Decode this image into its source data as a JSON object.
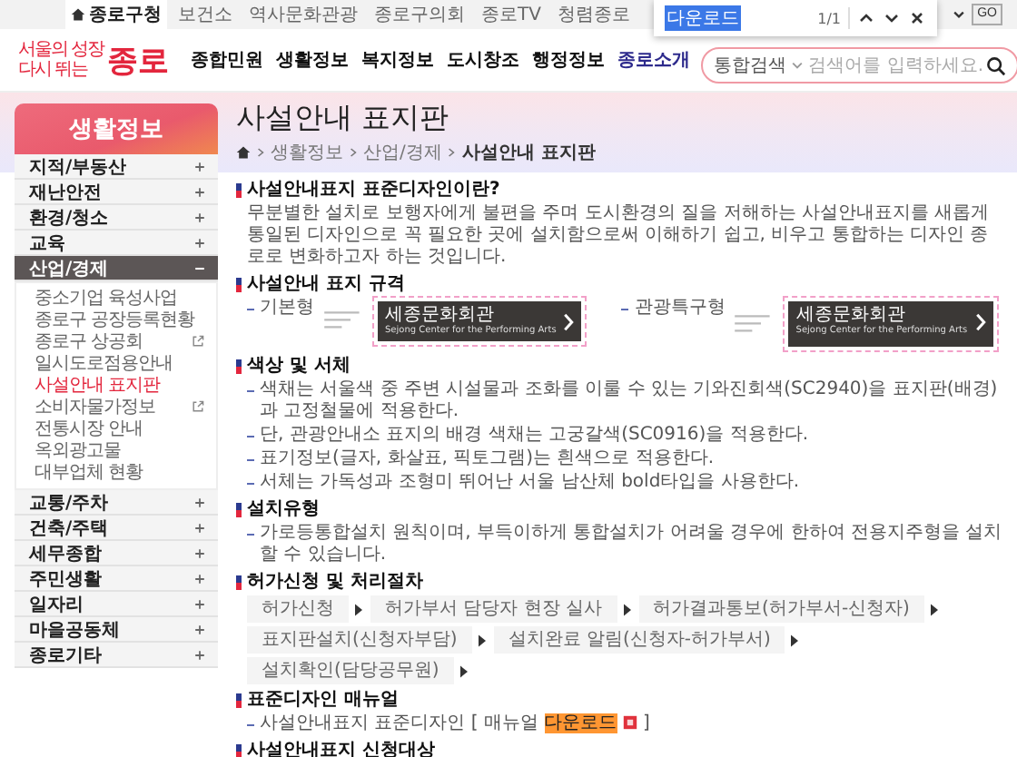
{
  "top_bar": {
    "links": [
      {
        "label": "종로구청",
        "selected": true
      },
      {
        "label": "보건소",
        "selected": false
      },
      {
        "label": "역사문화관광",
        "selected": false
      },
      {
        "label": "종로구의회",
        "selected": false
      },
      {
        "label": "종로TV",
        "selected": false
      },
      {
        "label": "청렴종로",
        "selected": false
      }
    ],
    "go_button": "GO"
  },
  "find_bar": {
    "value": "다운로드",
    "count": "1/1"
  },
  "header": {
    "logo": {
      "line_1": "서울의 성장",
      "line_2": "다시 뛰는",
      "name": "종로"
    },
    "nav": [
      {
        "label": "종합민원",
        "selected": false
      },
      {
        "label": "생활정보",
        "selected": false
      },
      {
        "label": "복지정보",
        "selected": false
      },
      {
        "label": "도시창조",
        "selected": false
      },
      {
        "label": "행정정보",
        "selected": false
      },
      {
        "label": "종로소개",
        "selected": true
      }
    ],
    "search": {
      "scope": "통합검색",
      "placeholder": "검색어를 입력하세요."
    }
  },
  "sidebar": {
    "title": "생활정보",
    "items": [
      {
        "label": "지적/부동산",
        "expanded": false
      },
      {
        "label": "재난안전",
        "expanded": false
      },
      {
        "label": "환경/청소",
        "expanded": false
      },
      {
        "label": "교육",
        "expanded": false
      },
      {
        "label": "산업/경제",
        "expanded": true,
        "children": [
          {
            "label": "중소기업 육성사업",
            "selected": false,
            "external": false
          },
          {
            "label": "종로구 공장등록현황",
            "selected": false,
            "external": false
          },
          {
            "label": "종로구 상공회",
            "selected": false,
            "external": true
          },
          {
            "label": "일시도로점용안내",
            "selected": false,
            "external": false
          },
          {
            "label": "사설안내 표지판",
            "selected": true,
            "external": false
          },
          {
            "label": "소비자물가정보",
            "selected": false,
            "external": true
          },
          {
            "label": "전통시장 안내",
            "selected": false,
            "external": false
          },
          {
            "label": "옥외광고물",
            "selected": false,
            "external": false
          },
          {
            "label": "대부업체 현황",
            "selected": false,
            "external": false
          }
        ]
      },
      {
        "label": "교통/주차",
        "expanded": false
      },
      {
        "label": "건축/주택",
        "expanded": false
      },
      {
        "label": "세무종합",
        "expanded": false
      },
      {
        "label": "주민생활",
        "expanded": false
      },
      {
        "label": "일자리",
        "expanded": false
      },
      {
        "label": "마을공동체",
        "expanded": false
      },
      {
        "label": "종로기타",
        "expanded": false
      }
    ]
  },
  "page": {
    "title": "사설안내 표지판",
    "breadcrumb": [
      "생활정보",
      "산업/경제",
      "사설안내 표지판"
    ],
    "sections": [
      {
        "kind": "paragraph",
        "heading": "사설안내표지 표준디자인이란?",
        "text": "무분별한 설치로 보행자에게 불편을 주며 도시환경의 질을 저해하는 사설안내표지를 새롭게 통일된 디자인으로 꼭 필요한 곳에 설치함으로써 이해하기 쉽고, 비우고 통합하는 디자인 종로로 변화하고자 하는 것입니다."
      },
      {
        "kind": "signs",
        "heading": "사설안내 표지 규격",
        "signs": [
          {
            "label": "기본형",
            "name": "세종문화회관",
            "english": "Sejong Center for the Performing Arts"
          },
          {
            "label": "관광특구형",
            "name": "세종문화회관",
            "english": "Sejong Center for the Performing Arts"
          }
        ]
      },
      {
        "kind": "bullets",
        "heading": "색상 및 서체",
        "items": [
          "색채는 서울색 중 주변 시설물과 조화를 이룰 수 있는 기와진회색(SC2940)을 표지판(배경)과 고정철물에 적용한다.",
          "단, 관광안내소 표지의 배경 색채는 고궁갈색(SC0916)을 적용한다.",
          "표기정보(글자, 화살표, 픽토그램)는 흰색으로 적용한다.",
          "서체는 가독성과 조형미 뛰어난 서울 남산체 bold타입을 사용한다."
        ]
      },
      {
        "kind": "bullets",
        "heading": "설치유형",
        "items": [
          "가로등통합설치 원칙이며, 부득이하게 통합설치가 어려울 경우에 한하여 전용지주형을 설치할 수 있습니다."
        ]
      },
      {
        "kind": "steps",
        "heading": "허가신청 및 처리절차",
        "steps": [
          "허가신청",
          "허가부서 담당자 현장 실사",
          "허가결과통보(허가부서-신청자)",
          "표지판설치(신청자부담)",
          "설치완료 알림(신청자-허가부서)",
          "설치확인(담당공무원)"
        ]
      },
      {
        "kind": "download",
        "heading": "표준디자인 매뉴얼",
        "prefix": "사설안내표지 표준디자인 [ 매뉴얼",
        "link": "다운로드",
        "highlighted": true,
        "suffix": "]"
      },
      {
        "kind": "heading",
        "heading": "사설안내표지 신청대상"
      }
    ]
  }
}
